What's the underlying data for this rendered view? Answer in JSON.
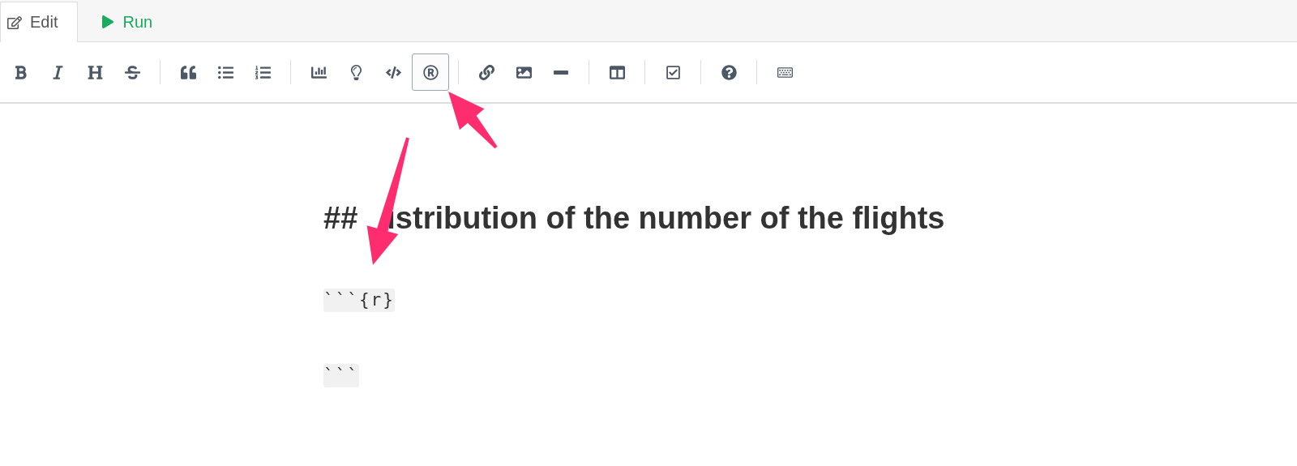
{
  "tabs": [
    {
      "kind": "edit",
      "label": "Edit",
      "selected": true
    },
    {
      "kind": "run",
      "label": "Run",
      "selected": false
    }
  ],
  "toolbar": {
    "groups": [
      {
        "buttons": [
          {
            "kind": "bold",
            "selected": false
          },
          {
            "kind": "italic",
            "selected": false
          },
          {
            "kind": "heading",
            "selected": false
          },
          {
            "kind": "strike",
            "selected": false
          }
        ]
      },
      {
        "buttons": [
          {
            "kind": "quote",
            "selected": false
          },
          {
            "kind": "bullets",
            "selected": false
          },
          {
            "kind": "numbers",
            "selected": false
          }
        ]
      },
      {
        "buttons": [
          {
            "kind": "chart",
            "selected": false
          },
          {
            "kind": "bulb",
            "selected": false
          },
          {
            "kind": "code",
            "selected": false
          },
          {
            "kind": "r",
            "selected": true
          }
        ]
      },
      {
        "buttons": [
          {
            "kind": "link",
            "selected": false
          },
          {
            "kind": "image",
            "selected": false
          },
          {
            "kind": "rule",
            "selected": false
          }
        ]
      },
      {
        "buttons": [
          {
            "kind": "columns",
            "selected": false
          }
        ]
      },
      {
        "buttons": [
          {
            "kind": "check",
            "selected": false
          }
        ]
      },
      {
        "buttons": [
          {
            "kind": "help",
            "selected": false
          }
        ]
      },
      {
        "buttons": [
          {
            "kind": "keyboard",
            "selected": false
          }
        ]
      }
    ]
  },
  "editor": {
    "lines": [
      {
        "kind": "heading",
        "parts": [
          "##",
          "istribution of the number of the flights"
        ]
      },
      {
        "kind": "code",
        "text": "```{r}"
      },
      {
        "kind": "code",
        "text": "```"
      }
    ]
  }
}
